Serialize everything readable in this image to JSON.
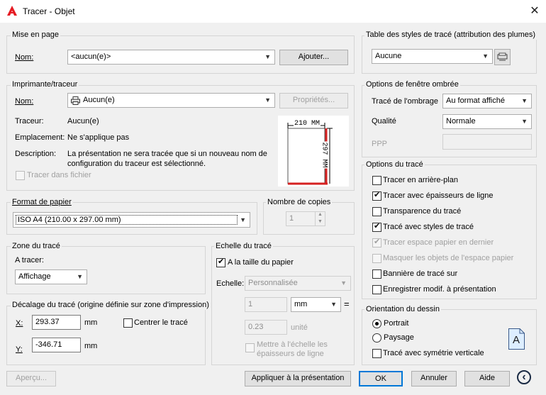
{
  "window": {
    "title": "Tracer - Objet"
  },
  "page_setup": {
    "group_title": "Mise en page",
    "name_label": "Nom:",
    "name_value": "<aucun(e)>",
    "add_button": "Ajouter..."
  },
  "printer": {
    "group_title": "Imprimante/traceur",
    "name_label": "Nom:",
    "name_value": "Aucun(e)",
    "properties_button": "Propriétés...",
    "plotter_label": "Traceur:",
    "plotter_value": "Aucun(e)",
    "location_label": "Emplacement:",
    "location_value": "Ne s'applique pas",
    "description_label": "Description:",
    "description_line1": "La présentation ne sera tracée que si un nouveau nom de",
    "description_line2": "configuration du traceur est sélectionné.",
    "plot_to_file": "Tracer dans fichier",
    "preview_width": "210  MM",
    "preview_height": "297 MM"
  },
  "paper_size": {
    "group_title": "Format de papier",
    "value": "ISO A4 (210.00 x 297.00 mm)"
  },
  "copies": {
    "group_title": "Nombre de copies",
    "value": "1"
  },
  "plot_area": {
    "group_title": "Zone du tracé",
    "what_label": "A tracer:",
    "what_value": "Affichage"
  },
  "plot_offset": {
    "group_title": "Décalage du tracé (origine définie sur zone d'impression)",
    "x_label": "X:",
    "x_value": "293.37",
    "y_label": "Y:",
    "y_value": "-346.71",
    "unit": "mm",
    "center_label": "Centrer le tracé"
  },
  "plot_scale": {
    "group_title": "Echelle du tracé",
    "fit_paper": "A la taille du papier",
    "scale_label": "Echelle:",
    "scale_value": "Personnalisée",
    "value1": "1",
    "unit_value": "mm",
    "equals": "=",
    "value2": "0.23",
    "unit2": "unité",
    "scale_lineweights_line1": "Mettre à l'échelle les",
    "scale_lineweights_line2": "épaisseurs de ligne"
  },
  "plot_style_table": {
    "group_title": "Table des styles de tracé (attribution des plumes)",
    "value": "Aucune"
  },
  "shaded_viewport": {
    "group_title": "Options de fenêtre ombrée",
    "shade_label": "Tracé de l'ombrage",
    "shade_value": "Au format affiché",
    "quality_label": "Qualité",
    "quality_value": "Normale",
    "dpi_label": "PPP"
  },
  "plot_options": {
    "group_title": "Options du tracé",
    "items": [
      {
        "label": "Tracer en arrière-plan",
        "checked": false,
        "disabled": false
      },
      {
        "label": "Tracer avec épaisseurs de ligne",
        "checked": true,
        "disabled": false
      },
      {
        "label": "Transparence du tracé",
        "checked": false,
        "disabled": false
      },
      {
        "label": "Tracé avec styles de tracé",
        "checked": true,
        "disabled": false
      },
      {
        "label": "Tracer espace papier en dernier",
        "checked": true,
        "disabled": true
      },
      {
        "label": "Masquer les objets de l'espace papier",
        "checked": false,
        "disabled": true
      },
      {
        "label": "Bannière de tracé sur",
        "checked": false,
        "disabled": false
      },
      {
        "label": "Enregistrer modif. à présentation",
        "checked": false,
        "disabled": false
      }
    ]
  },
  "orientation": {
    "group_title": "Orientation du dessin",
    "portrait": "Portrait",
    "landscape": "Paysage",
    "upside_down": "Tracé avec symétrie verticale",
    "orientation_glyph": "A"
  },
  "footer": {
    "preview_button": "Aperçu...",
    "apply_button": "Appliquer à la présentation",
    "ok_button": "OK",
    "cancel_button": "Annuler",
    "help_button": "Aide",
    "collapse_glyph": "‹"
  },
  "colors": {
    "accent": "#0078d7",
    "preview_red": "#d62121",
    "app_icon_red": "#e51b23"
  }
}
